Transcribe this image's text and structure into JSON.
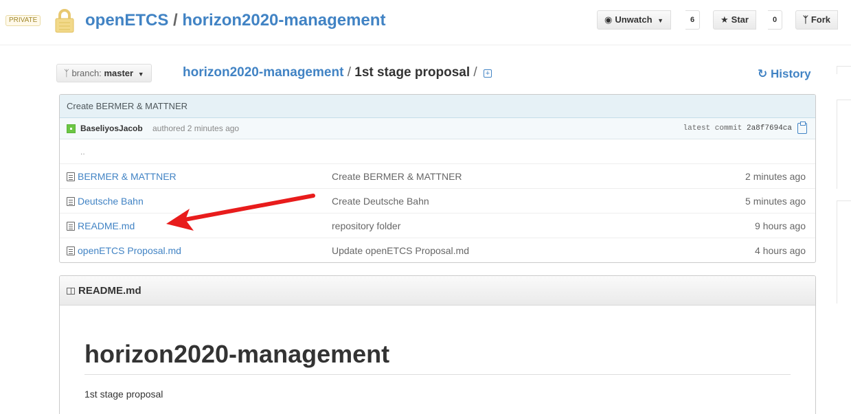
{
  "repo": {
    "private_label": "PRIVATE",
    "owner": "openETCS",
    "separator": "/",
    "name": "horizon2020-management"
  },
  "actions": {
    "unwatch_label": "Unwatch",
    "unwatch_count": "6",
    "star_label": "Star",
    "star_count": "0",
    "fork_label": "Fork"
  },
  "filenav": {
    "branch_prefix": "branch:",
    "branch_name": "master",
    "breadcrumb_root": "horizon2020-management",
    "breadcrumb_sep": "/",
    "breadcrumb_final": "1st stage proposal",
    "history_label": "History"
  },
  "commit": {
    "title": "Create BERMER & MATTNER",
    "author": "BaseliyosJacob",
    "authored_text": "authored 2 minutes ago",
    "latest_label": "latest commit",
    "sha": "2a8f7694ca"
  },
  "files": {
    "up_dir": "..",
    "rows": [
      {
        "name": "BERMER & MATTNER",
        "message": "Create BERMER & MATTNER",
        "age": "2 minutes ago"
      },
      {
        "name": "Deutsche Bahn",
        "message": "Create Deutsche Bahn",
        "age": "5 minutes ago"
      },
      {
        "name": "README.md",
        "message": "repository folder",
        "age": "9 hours ago"
      },
      {
        "name": "openETCS Proposal.md",
        "message": "Update openETCS Proposal.md",
        "age": "4 hours ago"
      }
    ]
  },
  "readme": {
    "header": "README.md",
    "h1": "horizon2020-management",
    "paragraph": "1st stage proposal"
  },
  "colors": {
    "link": "#4183c4",
    "commit_bg": "#e6f1f6",
    "annotation_arrow": "#e81c1c"
  }
}
